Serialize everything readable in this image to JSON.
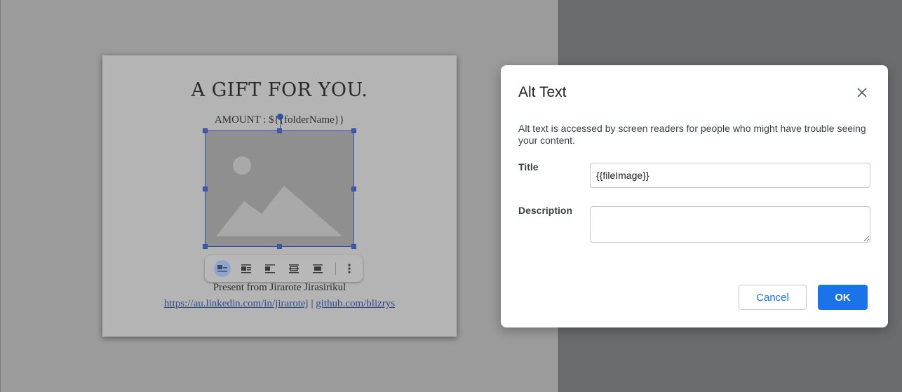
{
  "document": {
    "title": "A GIFT FOR YOU.",
    "amount_line": "AMOUNT : ${{folderName}}",
    "present_line": "Present from Jirarote Jirasirikul",
    "link_linkedin": "https://au.linkedin.com/in/jirarotej",
    "link_separator": " | ",
    "link_github": "github.com/blizrys"
  },
  "image_toolbar": {
    "buttons": [
      "inline-icon",
      "wrap-text-icon",
      "break-text-icon",
      "behind-text-icon",
      "in-front-of-text-icon",
      "more-options-icon"
    ],
    "active": "inline-icon"
  },
  "dialog": {
    "title": "Alt Text",
    "description": "Alt text is accessed by screen readers for people who might have trouble seeing your content.",
    "title_label": "Title",
    "title_value": "{{fileImage}}",
    "description_label": "Description",
    "description_value": "",
    "cancel_label": "Cancel",
    "ok_label": "OK"
  },
  "colors": {
    "accent": "#1a73e8",
    "selection": "#2f4fa8"
  }
}
